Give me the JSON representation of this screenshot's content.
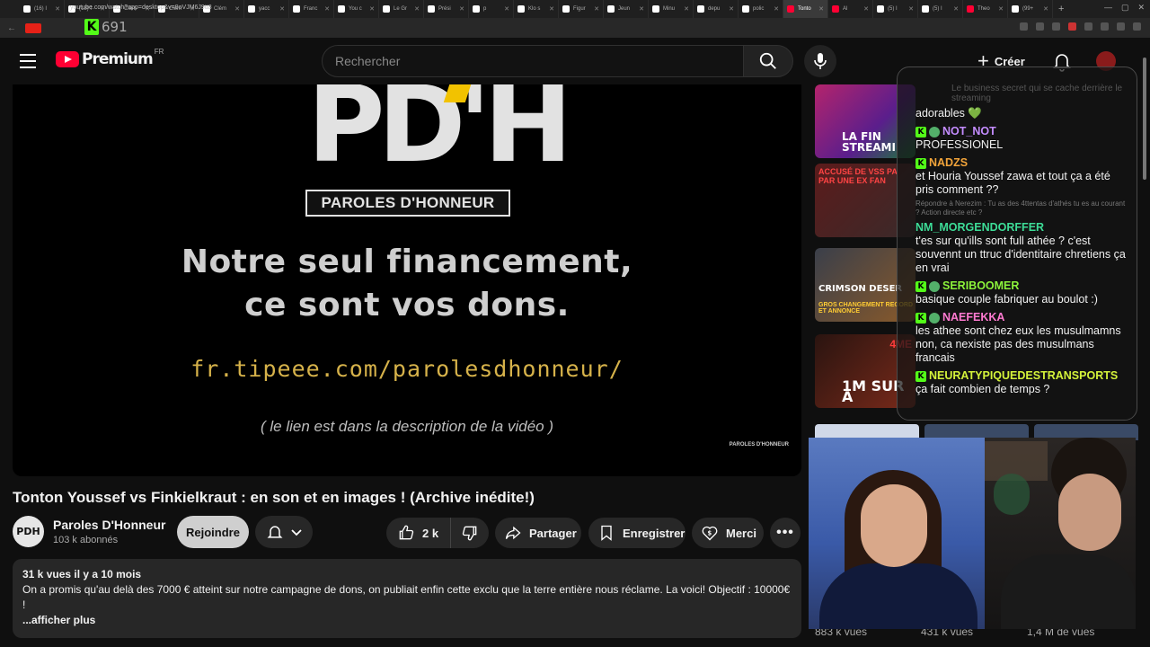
{
  "browser": {
    "tabs": [
      {
        "label": "(16) I",
        "type": "tw"
      },
      {
        "label": "(18) I",
        "type": "tw"
      },
      {
        "label": "Clém",
        "type": "tw"
      },
      {
        "label": "Clém",
        "type": "tw"
      },
      {
        "label": "Clém",
        "type": "tw"
      },
      {
        "label": "yacc",
        "type": "tw"
      },
      {
        "label": "Franc",
        "type": "tw"
      },
      {
        "label": "You c",
        "type": "tw"
      },
      {
        "label": "Le Gr",
        "type": "tw"
      },
      {
        "label": "Prési",
        "type": "tw"
      },
      {
        "label": "p",
        "type": "tw"
      },
      {
        "label": "Klo s",
        "type": "tw"
      },
      {
        "label": "Figur",
        "type": "tw"
      },
      {
        "label": "Jeun",
        "type": "tw"
      },
      {
        "label": "Minu",
        "type": "tw"
      },
      {
        "label": "depu",
        "type": "tw"
      },
      {
        "label": "polic",
        "type": "tw"
      },
      {
        "label": "Tonto",
        "type": "yt",
        "active": true
      },
      {
        "label": "Al",
        "type": "yt"
      },
      {
        "label": "(5) I",
        "type": "tw"
      },
      {
        "label": "(5) I",
        "type": "tw"
      },
      {
        "label": "Theo",
        "type": "yt"
      },
      {
        "label": "(99+",
        "type": "tw"
      }
    ],
    "url": "youtube.com/watch?app=desktop&v=8oVJM6J9tt8",
    "kick_count": "691"
  },
  "header": {
    "brand": "Premium",
    "country": "FR",
    "search_placeholder": "Rechercher",
    "create_label": "Créer"
  },
  "player": {
    "logo_letters": "PD'H",
    "logo_plate": "PAROLES D'HONNEUR",
    "promo_line1": "Notre seul financement,",
    "promo_line2": "ce sont vos dons.",
    "link": "fr.tipeee.com/parolesdhonneur/",
    "note": "( le lien est dans la description de la vidéo )",
    "watermark": "PAROLES D'HONNEUR"
  },
  "video": {
    "title": "Tonton Youssef vs Finkielkraut : en son et en images ! (Archive inédite!)",
    "channel_avatar": "PDH",
    "channel_name": "Paroles D'Honneur",
    "subscribers": "103 k abonnés",
    "join_label": "Rejoindre",
    "likes": "2 k",
    "share_label": "Partager",
    "save_label": "Enregistrer",
    "thanks_label": "Merci",
    "desc_meta": "31 k vues  il y a 10 mois",
    "desc_text": "On a promis qu'au delà des 7000 € atteint sur notre campagne de dons, on publiait enfin cette exclu que la terre entière nous réclame. La voici! Objectif : 10000€ !",
    "desc_more": "...afficher plus"
  },
  "sidebar": {
    "thumbs": [
      {
        "caption": "LA FIN STREAMI",
        "extra": ""
      },
      {
        "caption": "",
        "extra": "ACCUSÉ DE VSS PA PAR UNE EX FAN"
      },
      {
        "caption": "CRIMSON DESER",
        "extra": "GROS CHANGEMENT RECORD ET ANNONCE"
      },
      {
        "caption": "1M SUR A",
        "extra": "4ME"
      }
    ],
    "views": [
      "883 k vues",
      "431 k vues",
      "1,4 M de vues"
    ]
  },
  "chat": {
    "ghost_text": "Le business secret qui se cache derrière le streaming",
    "messages": [
      {
        "user": "",
        "text": "adorables 💚",
        "color": "",
        "badges": []
      },
      {
        "user": "NOT_NOT",
        "text": "PROFESSIONEL",
        "color": "u-purple",
        "badges": [
          "k",
          "s"
        ]
      },
      {
        "user": "NADZS",
        "text": "et Houria Youssef zawa et tout ça a été pris comment ??",
        "color": "u-orange",
        "badges": [
          "k"
        ]
      },
      {
        "user": "NM_MORGENDORFFER",
        "text": "t'es sur qu'ills sont full athée ? c'est souvennt un ttruc d'identitaire chretiens ça en vrai",
        "color": "u-teal",
        "badges": [],
        "reply": "Répondre à Nerezim : Tu as des 4ttentas d'athés tu es au courant ? Action directe etc ?"
      },
      {
        "user": "SERIBOOMER",
        "text": "basique couple fabriquer au boulot :)",
        "color": "u-lime",
        "badges": [
          "k",
          "s"
        ]
      },
      {
        "user": "NAEFEKKA",
        "text": "les athee sont chez eux les musulmamns non, ca nexiste pas des musulmans francais",
        "color": "u-pink",
        "badges": [
          "k",
          "s"
        ]
      },
      {
        "user": "NEURATYPIQUEDESTRANSPORTS",
        "text": "ça fait combien de temps ?",
        "color": "u-yellow",
        "badges": [
          "k"
        ]
      }
    ]
  },
  "colors": {
    "youtube_red": "#ff0033",
    "kick_green": "#53fc18",
    "tipeee_gold": "#d6b24a"
  }
}
